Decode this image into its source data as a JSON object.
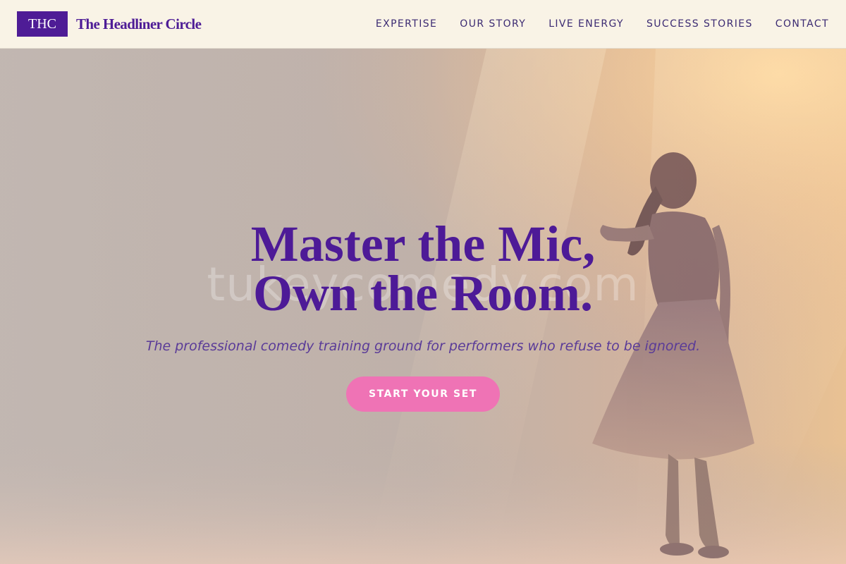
{
  "brand": {
    "logo_text": "THC",
    "name": "The Headliner Circle"
  },
  "nav": {
    "links": [
      "EXPERTISE",
      "OUR STORY",
      "LIVE ENERGY",
      "SUCCESS STORIES",
      "CONTACT"
    ]
  },
  "hero": {
    "headline_line1": "Master the Mic,",
    "headline_line2": "Own the Room.",
    "subtitle": "The professional comedy training ground for performers who refuse to be ignored.",
    "cta_label": "START YOUR SET",
    "watermark": "tukeycomedy.com"
  },
  "colors": {
    "brand_purple": "#4e1c96",
    "nav_text": "#3b2a72",
    "cta_pink": "#ef73b5",
    "navbar_bg": "#f9f3e6"
  }
}
